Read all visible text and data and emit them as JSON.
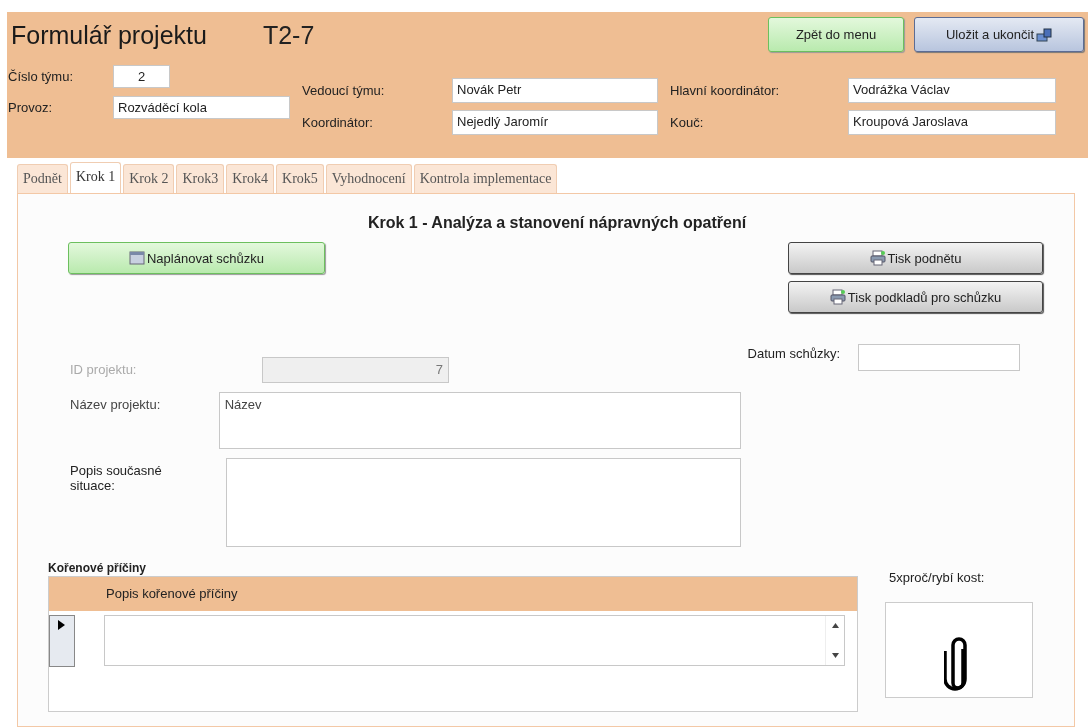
{
  "form": {
    "title": "Formulář projektu",
    "code": "T2-7"
  },
  "header_buttons": [
    {
      "label": "Zpět do menu",
      "kind": "back"
    },
    {
      "label": "Uložit a ukončit",
      "kind": "save"
    }
  ],
  "team": [
    {
      "label": "Číslo týmu:",
      "value": "2",
      "kind": "number"
    },
    {
      "label": "Provoz:",
      "value": "Rozváděcí kola",
      "kind": "text"
    }
  ],
  "people": [
    {
      "label": "Vedoucí týmu:",
      "value": "Novák Petr"
    },
    {
      "label": "Koordinátor:",
      "value": "Nejedlý Jaromír"
    },
    {
      "label": "Hlavní koordinátor:",
      "value": "Vodrážka Václav"
    },
    {
      "label": "Kouč:",
      "value": "Kroupová Jaroslava"
    }
  ],
  "tabs": [
    {
      "label": "Podnět",
      "selected": false
    },
    {
      "label": "Krok 1",
      "selected": true
    },
    {
      "label": "Krok 2",
      "selected": false
    },
    {
      "label": "Krok3",
      "selected": false
    },
    {
      "label": "Krok4",
      "selected": false
    },
    {
      "label": "Krok5",
      "selected": false
    },
    {
      "label": "Vyhodnocení",
      "selected": false
    },
    {
      "label": "Kontrola implementace",
      "selected": false
    }
  ],
  "tab_panel": {
    "heading": "Krok 1 - Analýza a stanovení nápravných opatření",
    "schedule_button": {
      "label": "Naplánovat schůzku"
    },
    "print_buttons": [
      {
        "label": "Tisk podnětu"
      },
      {
        "label": "Tisk podkladů pro schůzku"
      }
    ],
    "meeting_date": {
      "label": "Datum schůzky:"
    },
    "fields": [
      {
        "label": "ID projektu:",
        "value": "7",
        "kind": "id",
        "disabled": true
      },
      {
        "label": "Název projektu:",
        "value": "Název",
        "kind": "memo",
        "disabled": false
      },
      {
        "label": "Popis současné situace:",
        "kind": "large",
        "disabled": false
      }
    ],
    "root_causes": {
      "title": "Kořenové příčiny",
      "column": "Popis kořenové příčiny"
    },
    "attachment": {
      "label": "5xproč/rybí kost:"
    }
  }
}
